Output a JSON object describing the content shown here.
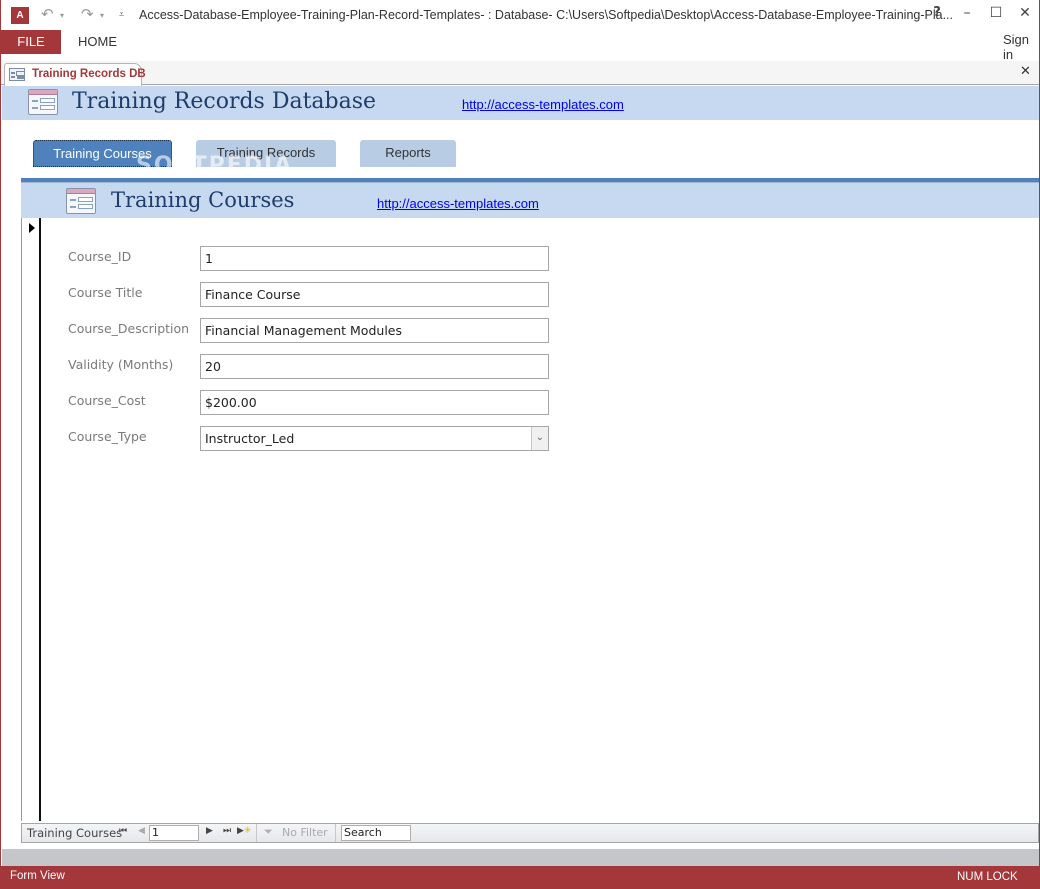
{
  "titlebar": {
    "app_icon": "A",
    "app_icon_name": "access-app-icon",
    "title": "Access-Database-Employee-Training-Plan-Record-Templates- : Database- C:\\Users\\Softpedia\\Desktop\\Access-Database-Employee-Training-Pla...",
    "help": "?",
    "minimize": "–",
    "maximize": "☐",
    "close": "✕",
    "undo_icon": "↶",
    "redo_icon": "↷",
    "dropdown_glyph": "▾",
    "customize_glyph": "⩡"
  },
  "ribbon": {
    "tabs": [
      {
        "label": "FILE",
        "active": true
      },
      {
        "label": "HOME",
        "active": false
      }
    ],
    "sign_in": "Sign in"
  },
  "document_tabs": {
    "active_tab": "Training Records DB",
    "close_glyph": "✕"
  },
  "main_header": {
    "title": "Training Records Database",
    "link": "http://access-templates.com"
  },
  "nav_buttons": [
    {
      "label": "Training Courses",
      "active": true
    },
    {
      "label": "Training Records",
      "active": false
    },
    {
      "label": "Reports",
      "active": false
    }
  ],
  "watermark": "SOFTPEDIA",
  "subform": {
    "header": {
      "title": "Training Courses",
      "link": "http://access-templates.com"
    },
    "fields": [
      {
        "label": "Course_ID",
        "value": "1",
        "type": "text"
      },
      {
        "label": "Course Title",
        "value": "Finance Course",
        "type": "text"
      },
      {
        "label": "Course_Description",
        "value": "Financial Management Modules",
        "type": "text"
      },
      {
        "label": "Validity (Months)",
        "value": "20",
        "type": "text"
      },
      {
        "label": "Course_Cost",
        "value": "$200.00",
        "type": "text"
      },
      {
        "label": "Course_Type",
        "value": "Instructor_Led",
        "type": "combo"
      }
    ],
    "combo_glyph": "⌄",
    "record_nav": {
      "caption": "Training Courses",
      "first": "⏮",
      "prev": "◀",
      "current_record": "1",
      "next": "▶",
      "last": "⏭",
      "new": "▶",
      "new_star": "✳",
      "filter_icon": "⏷",
      "filter_label": "No Filter",
      "search_value": "Search"
    }
  },
  "statusbar": {
    "view": "Form View",
    "indicator": "NUM LOCK"
  },
  "colors": {
    "brand": "#a4373a",
    "header_band": "#c6d9f1",
    "nav_active": "#4f81bd",
    "nav_inactive": "#b8cce4",
    "title_text": "#1f3d6b",
    "link": "#0000ee"
  }
}
